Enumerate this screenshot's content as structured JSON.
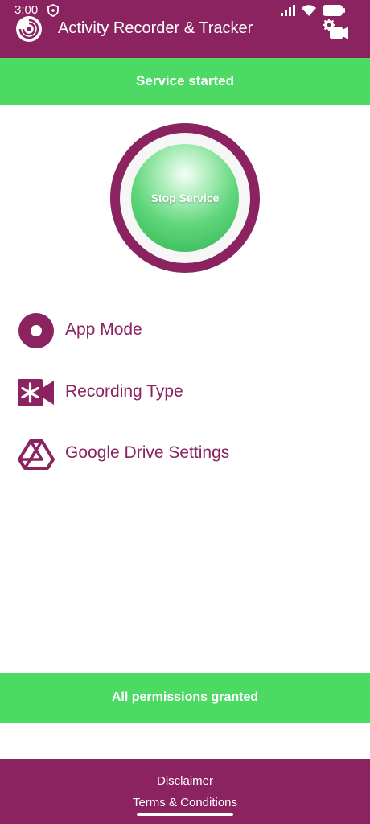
{
  "status_bar": {
    "time": "3:00"
  },
  "app_bar": {
    "title": "Activity Recorder & Tracker"
  },
  "service_banner": "Service started",
  "service_button": "Stop Service",
  "menu": [
    {
      "label": "App Mode",
      "icon": "record-circle-icon"
    },
    {
      "label": "Recording Type",
      "icon": "video-camera-icon"
    },
    {
      "label": "Google Drive Settings",
      "icon": "google-drive-icon"
    }
  ],
  "permissions_banner": "All permissions granted",
  "footer": {
    "disclaimer": "Disclaimer",
    "terms": "Terms & Conditions"
  },
  "colors": {
    "primary": "#8a2360",
    "success": "#4cd964",
    "background": "#ffffff"
  }
}
